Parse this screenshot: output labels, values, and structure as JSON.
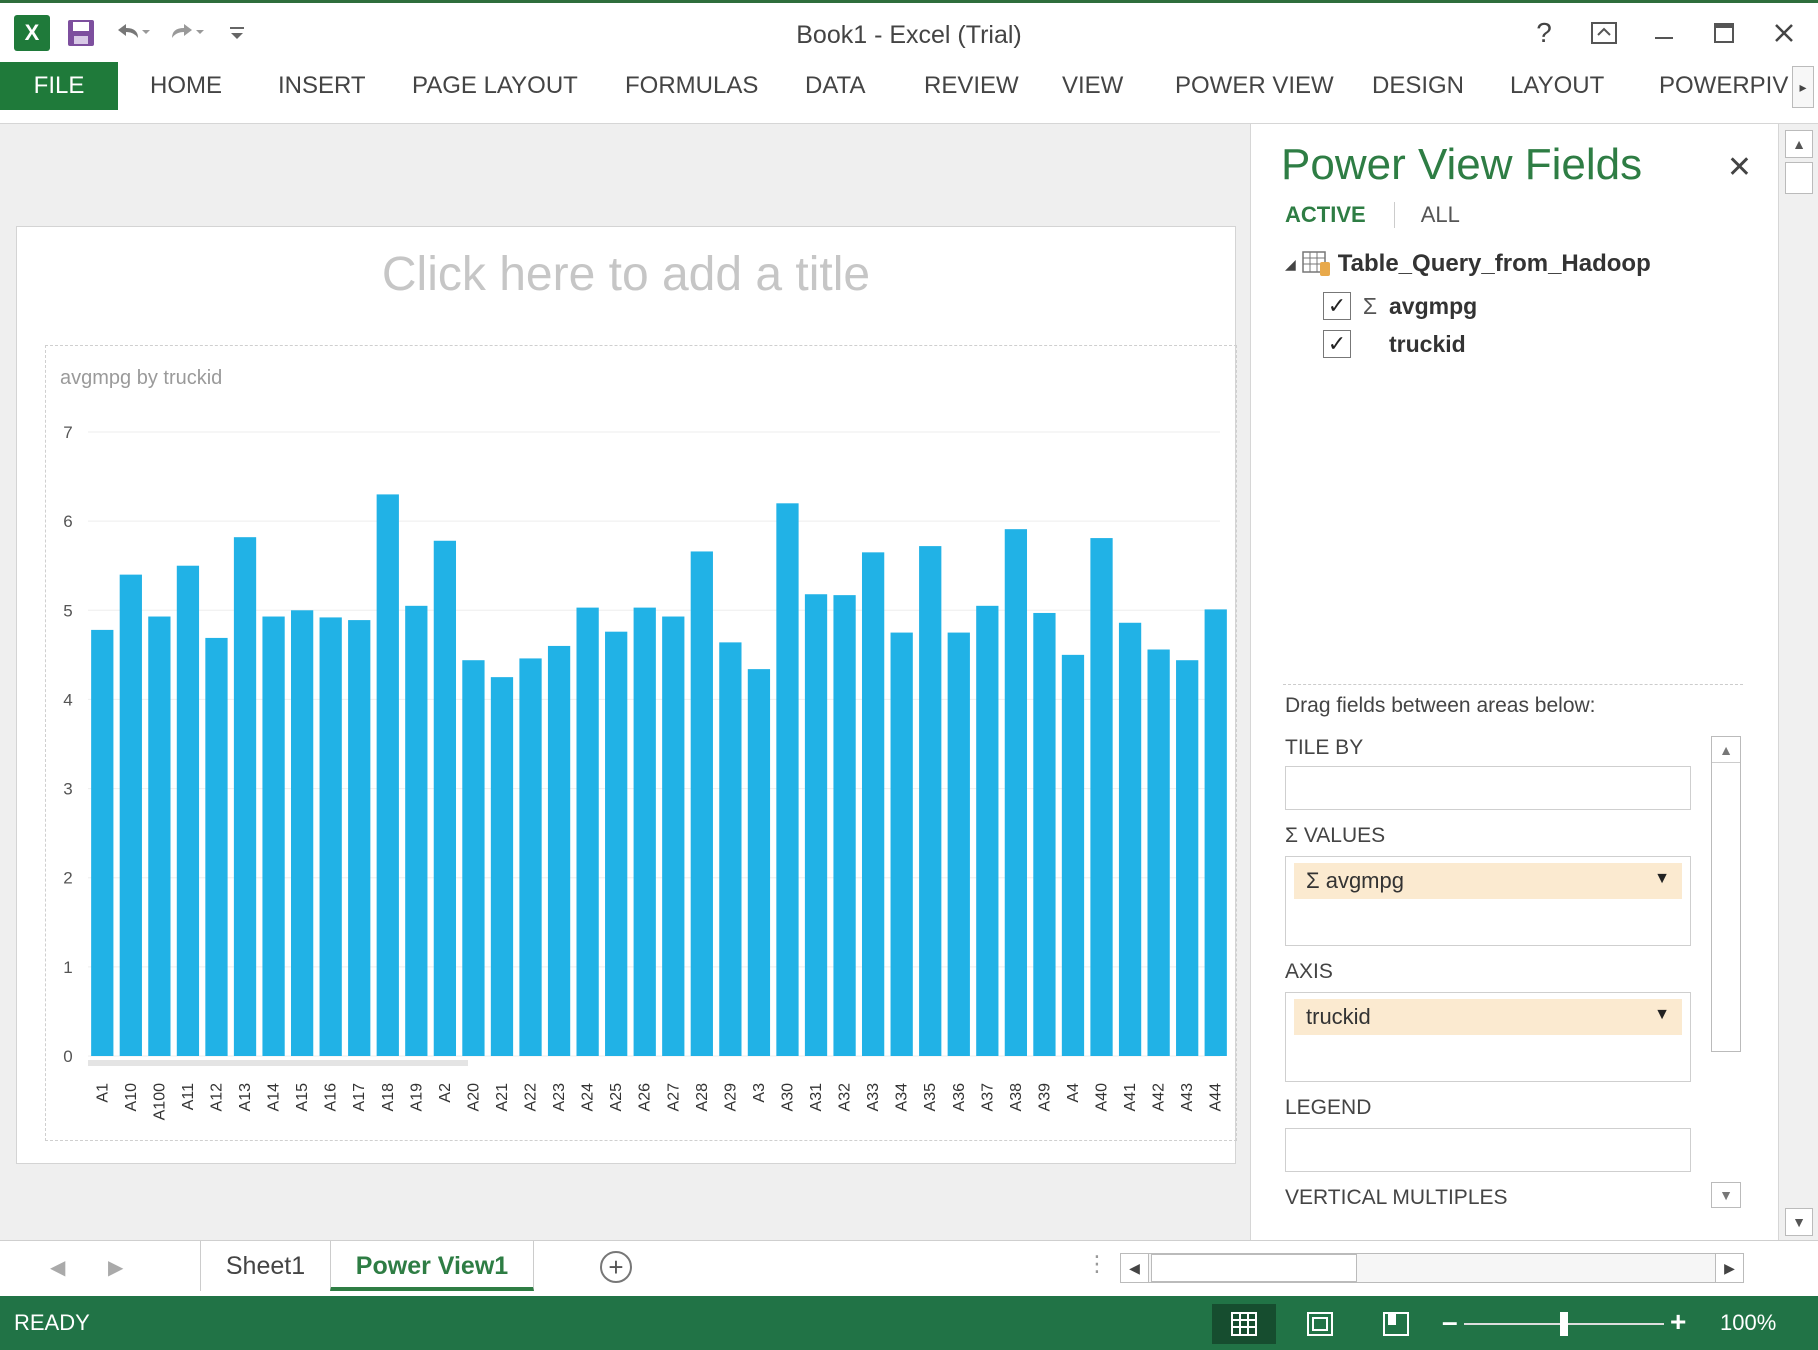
{
  "window": {
    "title": "Book1 - Excel (Trial)"
  },
  "qat": {
    "logo": "X",
    "icons": [
      "excel-logo-icon",
      "save-icon",
      "undo-icon",
      "redo-icon",
      "customize-qat-icon"
    ]
  },
  "window_controls": {
    "help": "?",
    "icons": [
      "help-icon",
      "ribbon-display-icon",
      "minimize-icon",
      "maximize-icon",
      "close-icon"
    ]
  },
  "ribbon": {
    "tabs": [
      "FILE",
      "HOME",
      "INSERT",
      "PAGE LAYOUT",
      "FORMULAS",
      "DATA",
      "REVIEW",
      "VIEW",
      "POWER VIEW",
      "DESIGN",
      "LAYOUT",
      "POWERPIVOT"
    ]
  },
  "canvas": {
    "title_placeholder": "Click here to add a title"
  },
  "chart_data": {
    "type": "bar",
    "title": "avgmpg by truckid",
    "categories": [
      "A1",
      "A10",
      "A100",
      "A11",
      "A12",
      "A13",
      "A14",
      "A15",
      "A16",
      "A17",
      "A18",
      "A19",
      "A2",
      "A20",
      "A21",
      "A22",
      "A23",
      "A24",
      "A25",
      "A26",
      "A27",
      "A28",
      "A29",
      "A3",
      "A30",
      "A31",
      "A32",
      "A33",
      "A34",
      "A35",
      "A36",
      "A37",
      "A38",
      "A39",
      "A4",
      "A40",
      "A41",
      "A42",
      "A43",
      "A44"
    ],
    "values": [
      4.78,
      5.4,
      4.93,
      5.5,
      4.69,
      5.82,
      4.93,
      5.0,
      4.92,
      4.89,
      6.3,
      5.05,
      5.78,
      4.44,
      4.25,
      4.46,
      4.6,
      5.03,
      4.76,
      5.03,
      4.93,
      5.66,
      4.64,
      4.34,
      6.2,
      5.18,
      5.17,
      5.65,
      4.75,
      5.72,
      4.75,
      5.05,
      5.91,
      4.97,
      4.5,
      5.81,
      4.86,
      4.56,
      4.44,
      5.01
    ],
    "yticks": [
      "0",
      "1",
      "2",
      "3",
      "4",
      "5",
      "6",
      "7"
    ],
    "ylim": [
      0,
      7
    ],
    "bar_color": "#21b2e6",
    "grid": true
  },
  "fields_pane": {
    "title": "Power View Fields",
    "tab_active": "ACTIVE",
    "tab_all": "ALL",
    "table_name": "Table_Query_from_Hadoop",
    "fields": [
      {
        "name": "avgmpg",
        "checked": "✓",
        "sigma": "Σ"
      },
      {
        "name": "truckid",
        "checked": "✓",
        "sigma": ""
      }
    ],
    "drag_hint": "Drag fields between areas below:",
    "tile_by_label": "TILE BY",
    "values_label": "Σ VALUES",
    "values_field": "Σ avgmpg",
    "axis_label": "AXIS",
    "axis_field": "truckid",
    "legend_label": "LEGEND",
    "vertical_multiples_label": "VERTICAL MULTIPLES"
  },
  "sheets": {
    "tabs": [
      "Sheet1",
      "Power View1"
    ],
    "active": "Power View1",
    "add_symbol": "+"
  },
  "status": {
    "text": "READY",
    "zoom": "100%"
  },
  "colors": {
    "excel_green": "#217346",
    "accent_green": "#2e7d44",
    "bar_blue": "#21b2e6"
  }
}
